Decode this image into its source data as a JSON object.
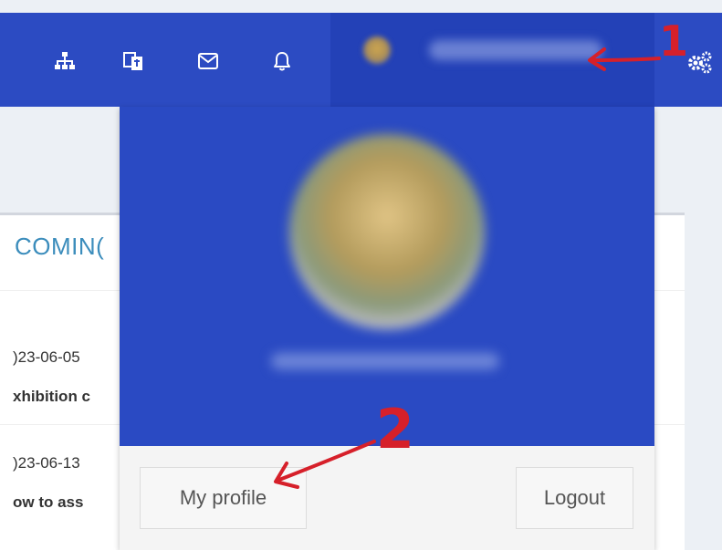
{
  "navbar": {
    "icons": [
      "sitemap-icon",
      "translate-icon",
      "envelope-icon",
      "bell-icon"
    ],
    "settings_icon": "cogs-icon"
  },
  "content": {
    "box_title": "COMIN(",
    "rows": [
      {
        "date": ")23-06-05",
        "title": "xhibition c"
      },
      {
        "date": ")23-06-13",
        "title": "ow to ass"
      }
    ]
  },
  "dropdown": {
    "my_profile_label": "My profile",
    "logout_label": "Logout"
  },
  "annotations": {
    "label_1": "1",
    "label_2": "2",
    "color": "#d6202a"
  },
  "colors": {
    "navbar": "#2c4bc2",
    "dropdown_header": "#2a4ac3",
    "accent_text": "#3c8dbc"
  }
}
